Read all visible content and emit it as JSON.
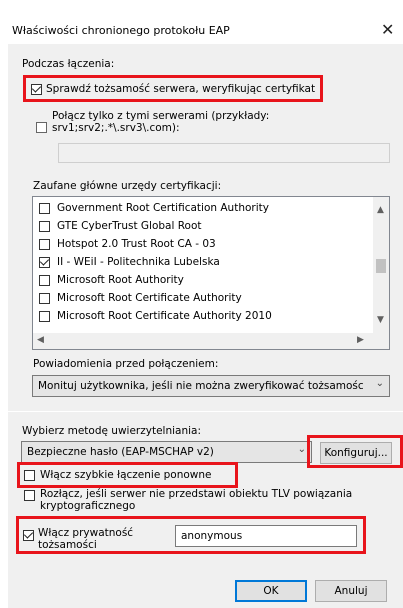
{
  "window": {
    "title": "Właściwości chronionego protokołu EAP",
    "close_glyph": "✕"
  },
  "connect_section": {
    "label": "Podczas łączenia:",
    "verify_server": {
      "label": "Sprawdź tożsamość serwera, weryfikując certyfikat",
      "checked": true
    },
    "connect_to_servers": {
      "label_line1": "Połącz tylko z tymi serwerami (przykłady:",
      "label_line2": "srv1;srv2;.*\\.srv3\\.com):",
      "checked": false
    },
    "servers_input": {
      "value": ""
    }
  },
  "trusted_ca": {
    "label": "Zaufane główne urzędy certyfikacji:",
    "items": [
      {
        "label": "Government Root Certification Authority",
        "checked": false
      },
      {
        "label": "GTE CyberTrust Global Root",
        "checked": false
      },
      {
        "label": "Hotspot 2.0 Trust Root CA - 03",
        "checked": false
      },
      {
        "label": "II - WEiI - Politechnika Lubelska",
        "checked": true
      },
      {
        "label": "Microsoft Root Authority",
        "checked": false
      },
      {
        "label": "Microsoft Root Certificate Authority",
        "checked": false
      },
      {
        "label": "Microsoft Root Certificate Authority 2010",
        "checked": false
      }
    ]
  },
  "notifications": {
    "label": "Powiadomienia przed połączeniem:",
    "selected": "Monituj użytkownika, jeśli nie można zweryfikować tożsamości ser"
  },
  "auth_method": {
    "label": "Wybierz metodę uwierzytelniania:",
    "selected": "Bezpieczne hasło (EAP-MSCHAP v2)",
    "configure_button": "Konfiguruj..."
  },
  "options": {
    "fast_reconnect": {
      "label": "Włącz szybkie łączenie ponowne",
      "checked": false
    },
    "disconnect_tlv": {
      "label_line1": "Rozłącz, jeśli serwer nie przedstawi obiektu TLV powiązania",
      "label_line2": "kryptograficznego",
      "checked": false
    },
    "identity_privacy": {
      "label_line1": "Włącz prywatność",
      "label_line2": "tożsamości",
      "checked": true,
      "value": "anonymous"
    }
  },
  "footer": {
    "ok_button": "OK",
    "cancel_button": "Anuluj"
  },
  "colors": {
    "highlight_red": "#e8141b",
    "panel_bg": "#f0f0f0",
    "default_button_border": "#0078d7"
  }
}
